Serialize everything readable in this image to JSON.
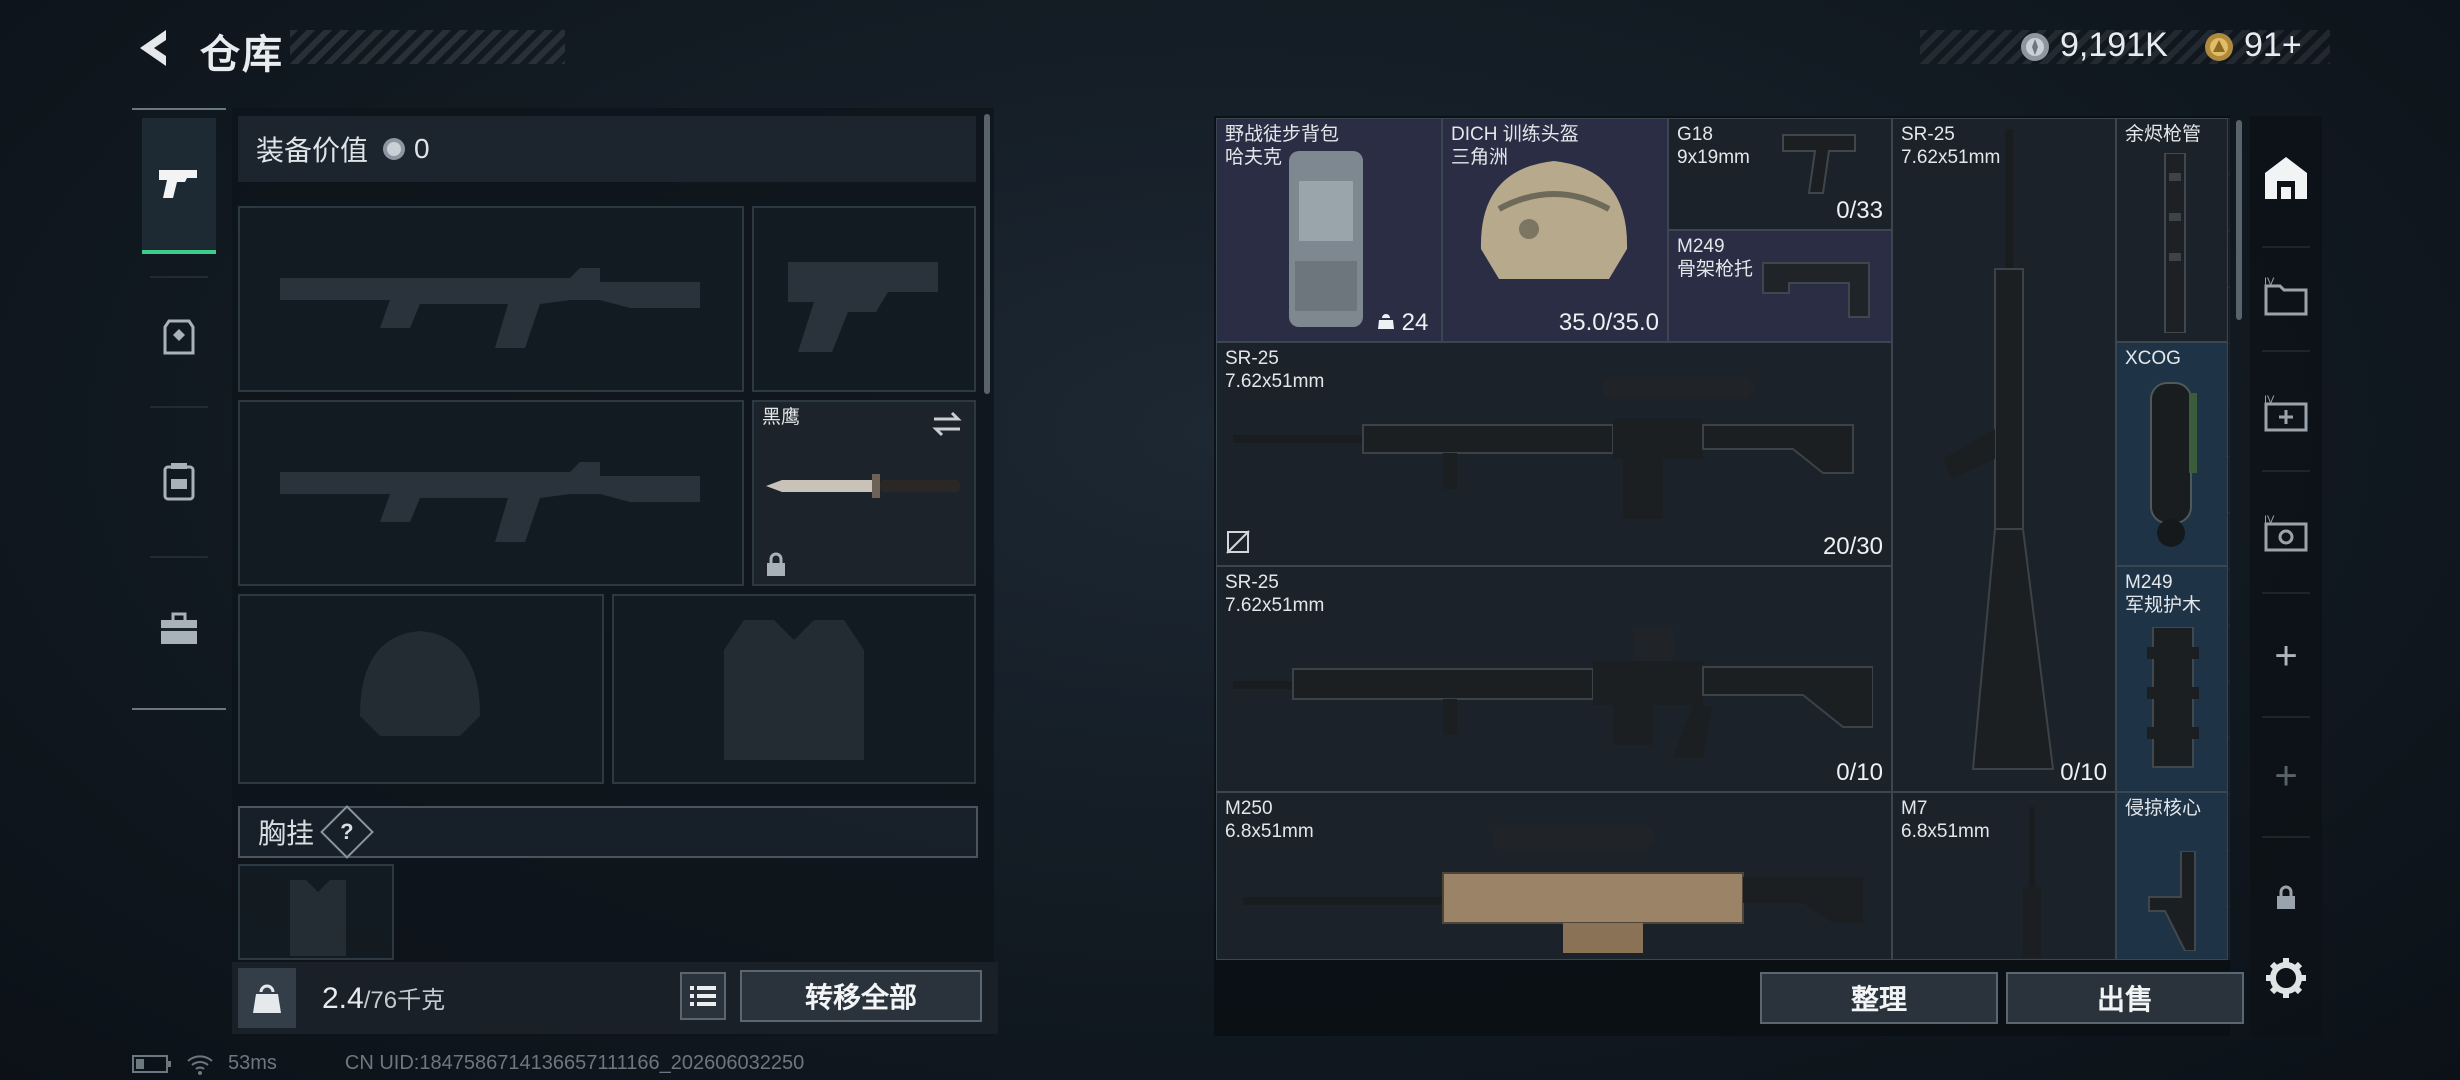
{
  "header": {
    "title": "仓库",
    "currency_1": "9,191K",
    "currency_2": "91+"
  },
  "loadout": {
    "equip_value_label": "装备价值",
    "equip_value": "0",
    "melee_name": "黑鹰",
    "chest_label": "胸挂",
    "chest_help": "?",
    "weight_current": "2.4",
    "weight_max": "/76千克",
    "transfer_all": "转移全部"
  },
  "storage": {
    "items": [
      {
        "id": "backpack",
        "line1": "野战徒步背包",
        "line2": "哈夫克",
        "count": "24",
        "tier": "purple"
      },
      {
        "id": "helmet",
        "line1": "DICH 训练头盔",
        "line2": "三角洲",
        "count": "35.0/35.0",
        "tier": "purple"
      },
      {
        "id": "g18",
        "line1": "G18",
        "line2": "9x19mm",
        "count": "0/33",
        "tier": "gray"
      },
      {
        "id": "m249stock",
        "line1": "M249",
        "line2": "骨架枪托",
        "count": "",
        "tier": "purple"
      },
      {
        "id": "sr25-vertical",
        "line1": "SR-25",
        "line2": "7.62x51mm",
        "count": "0/10",
        "tier": "gray"
      },
      {
        "id": "barrel",
        "line1": "余烬枪管",
        "line2": "",
        "count": "",
        "tier": "gray"
      },
      {
        "id": "sr25-a",
        "line1": "SR-25",
        "line2": "7.62x51mm",
        "count": "20/30",
        "tier": "gray"
      },
      {
        "id": "xcog",
        "line1": "XCOG",
        "line2": "",
        "count": "",
        "tier": "blue"
      },
      {
        "id": "sr25-b",
        "line1": "SR-25",
        "line2": "7.62x51mm",
        "count": "0/10",
        "tier": "gray"
      },
      {
        "id": "m249guard",
        "line1": "M249",
        "line2": "军规护木",
        "count": "",
        "tier": "blue"
      },
      {
        "id": "m250",
        "line1": "M250",
        "line2": "6.8x51mm",
        "count": "",
        "tier": "gray"
      },
      {
        "id": "m7",
        "line1": "M7",
        "line2": "6.8x51mm",
        "count": "",
        "tier": "gray"
      },
      {
        "id": "core",
        "line1": "侵掠核心",
        "line2": "",
        "count": "",
        "tier": "blue"
      }
    ],
    "sort_button": "整理",
    "sell_button": "出售"
  },
  "rail": {
    "plus_1": "+",
    "plus_2": "+"
  },
  "status": {
    "ping": "53ms",
    "uid": "CN UID:1847586714136657111166_202606032250"
  },
  "colors": {
    "accent_green": "#3dcc8a",
    "tier_purple": "#2a2d44",
    "tier_blue": "#1f3347"
  }
}
